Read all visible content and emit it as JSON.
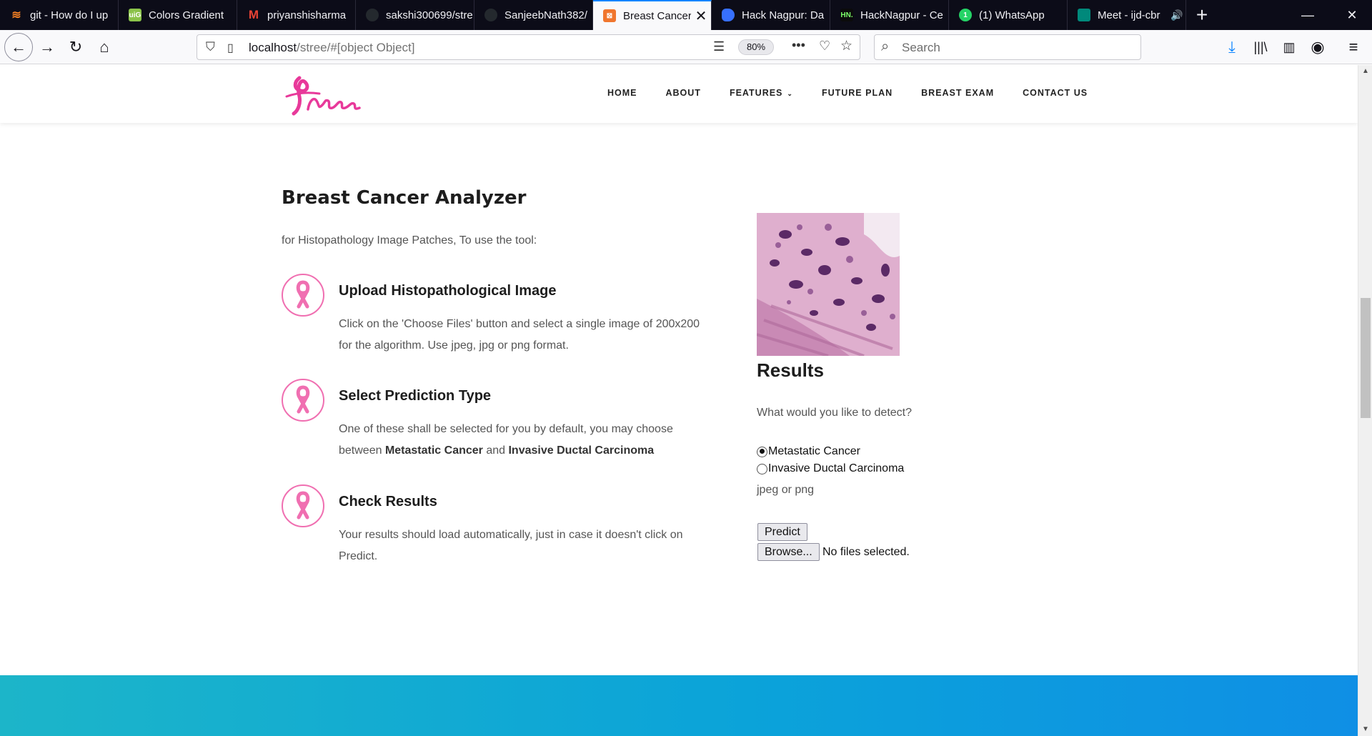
{
  "browser": {
    "tabs": [
      {
        "title": "git - How do I up",
        "favicon": "stackoverflow-icon",
        "color": "#f48024"
      },
      {
        "title": "Colors Gradient",
        "favicon": "uigradients-icon",
        "color": "#8bc34a"
      },
      {
        "title": "priyanshisharma",
        "favicon": "gmail-icon",
        "color": "#ea4335"
      },
      {
        "title": "sakshi300699/stre",
        "favicon": "github-icon",
        "color": "#24292e"
      },
      {
        "title": "SanjeebNath382/",
        "favicon": "github-icon",
        "color": "#24292e"
      },
      {
        "title": "Breast Cancer",
        "favicon": "site-icon",
        "color": "#f0762e",
        "active": true
      },
      {
        "title": "Hack Nagpur: Da",
        "favicon": "devfolio-icon",
        "color": "#3770ff"
      },
      {
        "title": "HackNagpur - Ce",
        "favicon": "hn-icon",
        "color": "#0b0b0b"
      },
      {
        "title": "(1) WhatsApp",
        "favicon": "whatsapp-icon",
        "color": "#25d366"
      },
      {
        "title": "Meet - ijd-cbr",
        "favicon": "meet-icon",
        "color": "#00897b"
      }
    ],
    "url_host": "localhost",
    "url_path": "/stree/#[object Object]",
    "zoom": "80%",
    "search_placeholder": "Search"
  },
  "site": {
    "menu": [
      "HOME",
      "ABOUT",
      "FEATURES",
      "FUTURE PLAN",
      "BREAST EXAM",
      "CONTACT US"
    ],
    "brand_color": "#e8399a"
  },
  "analyzer": {
    "title": "Breast Cancer Analyzer",
    "intro": "for Histopathology Image Patches, To use the tool:",
    "steps": [
      {
        "title": "Upload Histopathological Image",
        "text_1": "Click on the 'Choose Files' button and select a single image of 200x200",
        "text_2": "for the algorithm. Use jpeg, jpg or png format."
      },
      {
        "title": "Select Prediction Type",
        "text_1": "One of these shall be selected for you by default, you may choose",
        "text_2_pre": "between ",
        "text_2_b1": "Metastatic Cancer",
        "text_2_mid": " and ",
        "text_2_b2": "Invasive Ductal Carcinoma"
      },
      {
        "title": "Check Results",
        "text_1": "Your results should load automatically, just in case it doesn't click on",
        "text_2": "Predict."
      }
    ]
  },
  "results": {
    "title": "Results",
    "question": "What would you like to detect?",
    "options": [
      {
        "label": "Metastatic Cancer",
        "checked": true
      },
      {
        "label": "Invasive Ductal Carcinoma",
        "checked": false
      }
    ],
    "format_hint": "jpeg or png",
    "predict_label": "Predict",
    "browse_label": "Browse...",
    "no_files": "No files selected."
  }
}
